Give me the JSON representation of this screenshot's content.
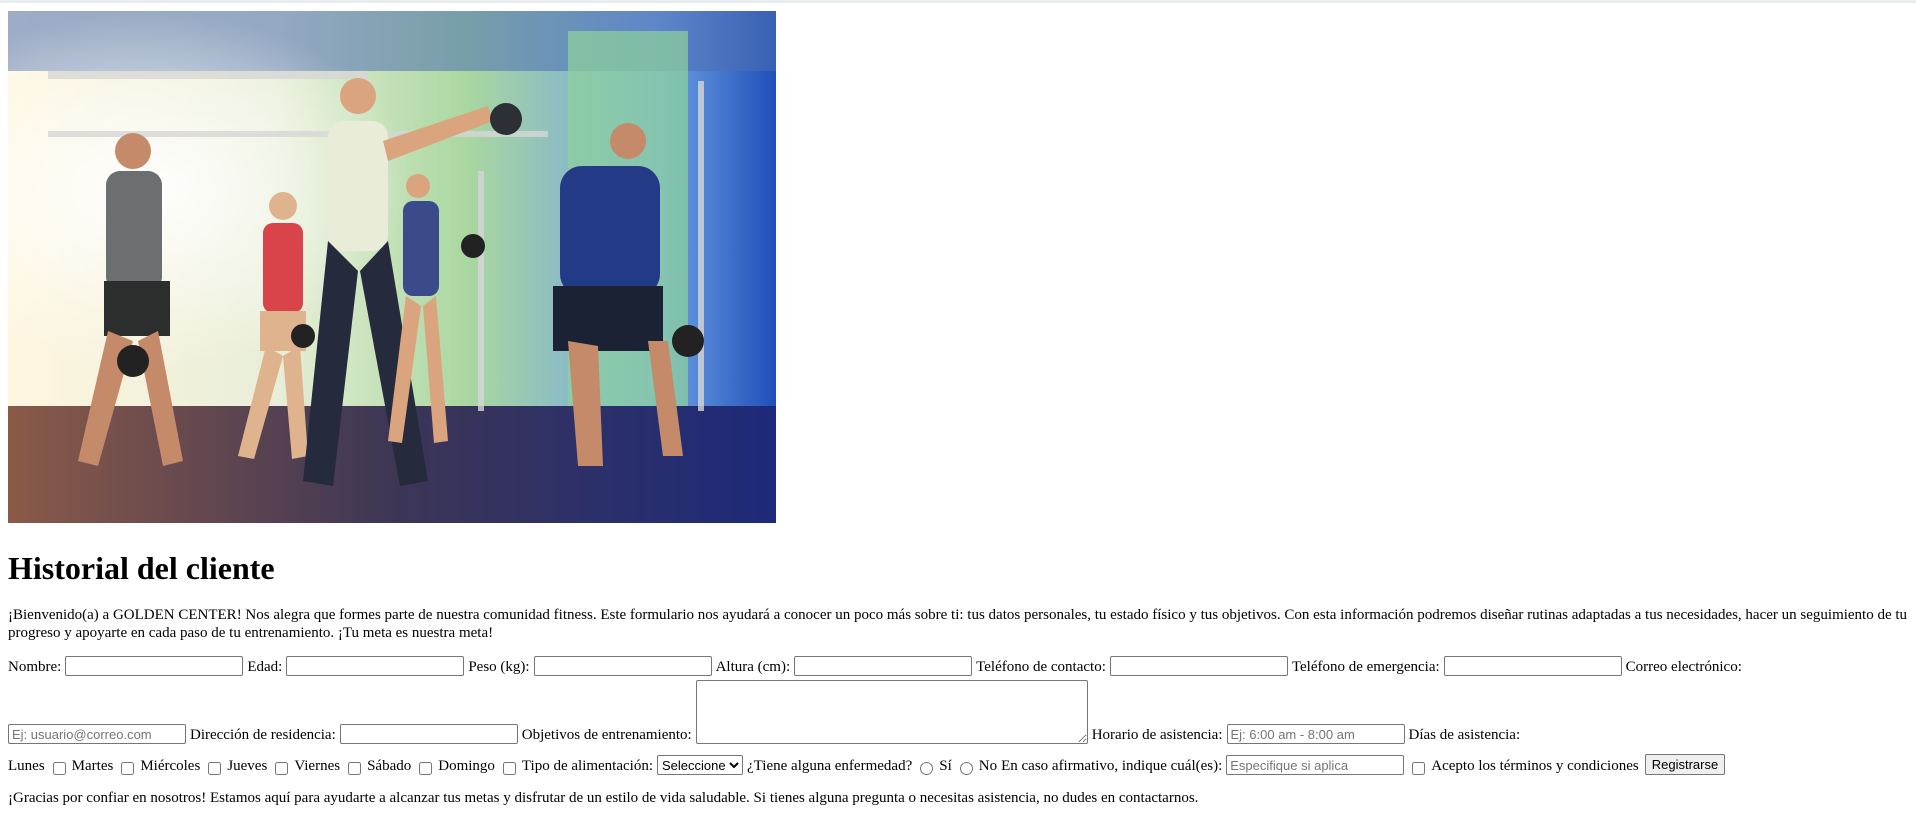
{
  "image": {
    "alt": "Grupo entrenando con pesas rusas en el gimnasio",
    "colors": {
      "sky": "#7fb2ff",
      "floor": "#2d2a5a",
      "wall": "#cfe8c4"
    }
  },
  "title": "Historial del cliente",
  "intro": "¡Bienvenido(a) a GOLDEN CENTER! Nos alegra que formes parte de nuestra comunidad fitness. Este formulario nos ayudará a conocer un poco más sobre ti: tus datos personales, tu estado físico y tus objetivos. Con esta información podremos diseñar rutinas adaptadas a tus necesidades, hacer un seguimiento de tu progreso y apoyarte en cada paso de tu entrenamiento. ¡Tu meta es nuestra meta!",
  "form": {
    "nombre_label": "Nombre:",
    "nombre_value": "",
    "edad_label": "Edad:",
    "edad_value": "",
    "peso_label": "Peso (kg):",
    "peso_value": "",
    "altura_label": "Altura (cm):",
    "altura_value": "",
    "telefono_label": "Teléfono de contacto:",
    "telefono_value": "",
    "emergencia_label": "Teléfono de emergencia:",
    "emergencia_value": "",
    "correo_label": "Correo electrónico:",
    "correo_placeholder": "Ej: usuario@correo.com",
    "direccion_label": "Dirección de residencia:",
    "direccion_value": "",
    "objetivos_label": "Objetivos de entrenamiento:",
    "objetivos_value": "",
    "horario_label": "Horario de asistencia:",
    "horario_placeholder": "Ej: 6:00 am - 8:00 am",
    "dias_label": "Días de asistencia:",
    "dias": [
      "Lunes",
      "Martes",
      "Miércoles",
      "Jueves",
      "Viernes",
      "Sábado",
      "Domingo"
    ],
    "alimentacion_label": "Tipo de alimentación:",
    "alimentacion_selected": "Seleccione",
    "enfermedad_label": "¿Tiene alguna enfermedad?",
    "enfermedad_si": "Sí",
    "enfermedad_no": "No",
    "cual_label": "En caso afirmativo, indique cuál(es):",
    "cual_placeholder": "Especifique si aplica",
    "terminos_label": "Acepto los términos y condiciones",
    "registrarse_label": "Registrarse"
  },
  "thanks": "¡Gracias por confiar en nosotros! Estamos aquí para ayudarte a alcanzar tus metas y disfrutar de un estilo de vida saludable. Si tienes alguna pregunta o necesitas asistencia, no dudes en contactarnos."
}
